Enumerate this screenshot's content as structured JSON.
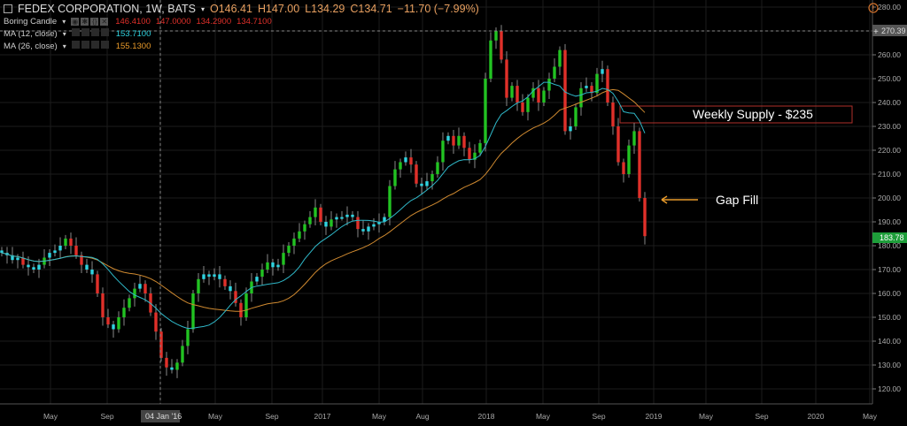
{
  "header": {
    "symbol": "FEDEX CORPORATION, 1W, BATS",
    "open": "O146.41",
    "high": "H147.00",
    "low": "L134.29",
    "close": "C134.71",
    "change": "−11.70 (−7.99%)"
  },
  "indicators": [
    {
      "label": "Boring Candle",
      "values": [
        "146.4100",
        "147.0000",
        "134.2900",
        "134.7100"
      ],
      "color": "#e0302a"
    },
    {
      "label": "MA (12, close)",
      "values": [
        "153.7100"
      ],
      "color": "#2fd3e0"
    },
    {
      "label": "MA (26, close)",
      "values": [
        "155.1300"
      ],
      "color": "#e89a2a"
    }
  ],
  "annotations": {
    "supply": "Weekly Supply - $235",
    "gap": "Gap Fill"
  },
  "crosshair": {
    "date": "04 Jan '16",
    "price": "270.39"
  },
  "last_price": "183.78",
  "colors": {
    "up": "#22c322",
    "down": "#e0302a",
    "boring": "#2fd3e0",
    "ma12": "#2fb8c8",
    "ma26": "#d08a30",
    "bg": "#000000"
  },
  "chart_data": {
    "type": "candlestick",
    "title": "FEDEX CORPORATION, 1W, BATS",
    "ylim": [
      115,
      282
    ],
    "y_ticks": [
      "120.00",
      "130.00",
      "140.00",
      "150.00",
      "160.00",
      "170.00",
      "180.00",
      "190.00",
      "200.00",
      "210.00",
      "220.00",
      "230.00",
      "240.00",
      "250.00",
      "260.00",
      "270.00",
      "280.00"
    ],
    "x_ticks": [
      "May",
      "Sep",
      "04 Jan '16",
      "May",
      "Sep",
      "2017",
      "May",
      "Aug",
      "2018",
      "May",
      "Sep",
      "2019",
      "May",
      "Sep",
      "2020",
      "May"
    ],
    "supply_zone": [
      231,
      239
    ],
    "closes": [
      177,
      176,
      174,
      175,
      172,
      171,
      170,
      172,
      175,
      177,
      178,
      180,
      183,
      180,
      176,
      172,
      170,
      168,
      160,
      150,
      147,
      145,
      150,
      154,
      158,
      162,
      164,
      160,
      152,
      144,
      133,
      129,
      128,
      131,
      138,
      145,
      160,
      166,
      168,
      167,
      168,
      166,
      163,
      161,
      156,
      150,
      160,
      165,
      167,
      170,
      173,
      171,
      172,
      177,
      180,
      183,
      186,
      189,
      192,
      196,
      190,
      188,
      191,
      192,
      192,
      193,
      192,
      187,
      186,
      188,
      189,
      190,
      192,
      205,
      212,
      215,
      217,
      214,
      206,
      205,
      207,
      210,
      215,
      224,
      226,
      222,
      226,
      221,
      216,
      219,
      223,
      250,
      266,
      270,
      258,
      242,
      247,
      240,
      236,
      242,
      246,
      240,
      245,
      250,
      255,
      262,
      228,
      230,
      238,
      246,
      247,
      244,
      252,
      254,
      240,
      230,
      215,
      210,
      222,
      228,
      200,
      184
    ],
    "moving_averages": [
      "MA (12, close)",
      "MA (26, close)"
    ]
  }
}
